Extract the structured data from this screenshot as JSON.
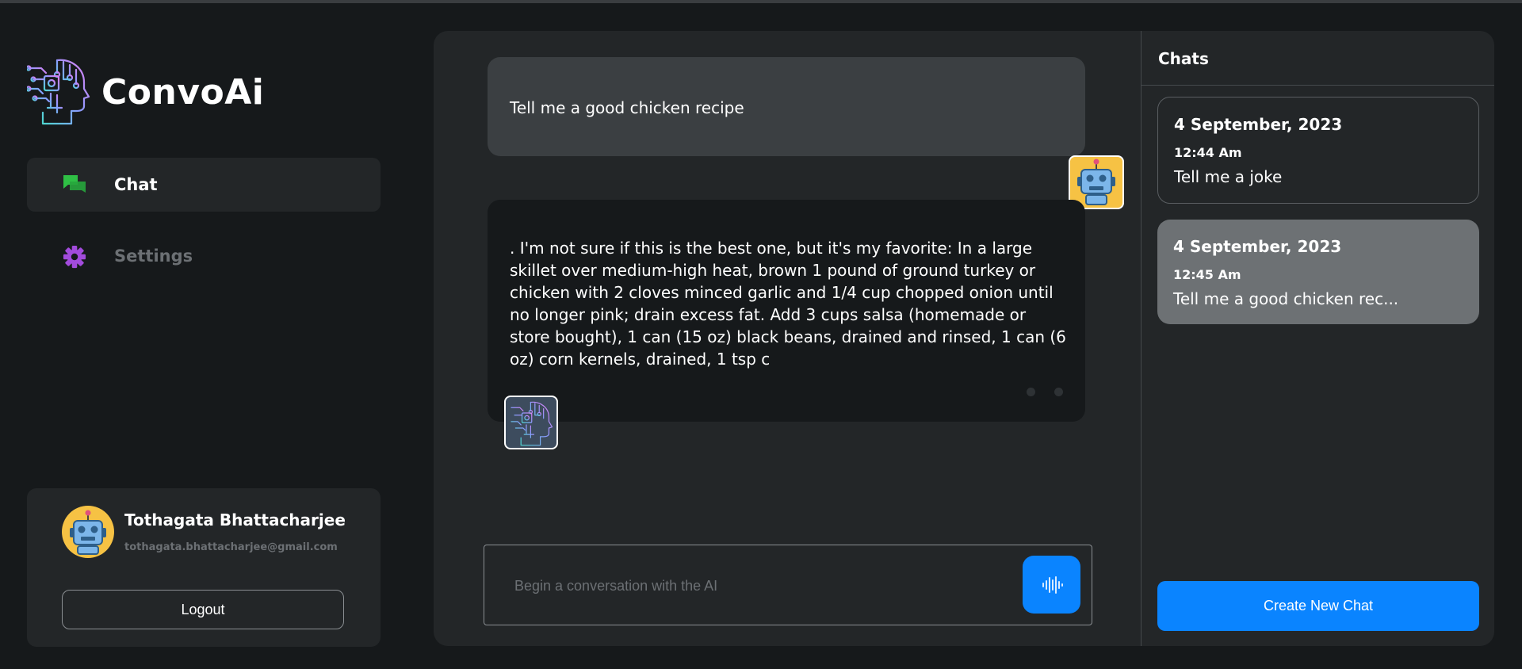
{
  "brand": {
    "name": "ConvoAi",
    "logo_icon": "ai-head-circuit-icon"
  },
  "nav": {
    "items": [
      {
        "label": "Chat",
        "icon": "chat-bubbles-icon",
        "active": true,
        "icon_color": "#2fbf45"
      },
      {
        "label": "Settings",
        "icon": "gear-icon",
        "active": false,
        "icon_color": "#a24bdc"
      }
    ]
  },
  "profile": {
    "name": "Tothagata Bhattacharjee",
    "email": "tothagata.bhattacharjee@gmail.com",
    "avatar_icon": "robot-avatar-icon",
    "logout_label": "Logout"
  },
  "conversation": {
    "messages": [
      {
        "role": "user",
        "text": "Tell me a good chicken recipe",
        "avatar_icon": "robot-avatar-icon"
      },
      {
        "role": "ai",
        "text": ". I'm not sure if this is the best one, but it's my favorite: In a large skillet over medium-high heat, brown 1 pound of ground turkey or chicken with 2 cloves minced garlic and 1/4 cup chopped onion until no longer pink; drain excess fat. Add 3 cups salsa (homemade or store bought), 1 can (15 oz) black beans, drained and rinsed, 1 can (6 oz) corn kernels, drained, 1 tsp c",
        "avatar_icon": "ai-head-circuit-icon"
      }
    ]
  },
  "composer": {
    "placeholder": "Begin a conversation with the AI",
    "value": "",
    "mic_icon": "voice-waveform-icon"
  },
  "chats": {
    "title": "Chats",
    "items": [
      {
        "date": "4 September, 2023",
        "time": "12:44 Am",
        "preview": "Tell me a joke",
        "selected": false
      },
      {
        "date": "4 September, 2023",
        "time": "12:45 Am",
        "preview": "Tell me a good chicken rec...",
        "selected": true
      }
    ],
    "new_chat_label": "Create New Chat"
  },
  "colors": {
    "accent": "#0a84ff",
    "background": "#16191b",
    "panel": "#232628"
  }
}
